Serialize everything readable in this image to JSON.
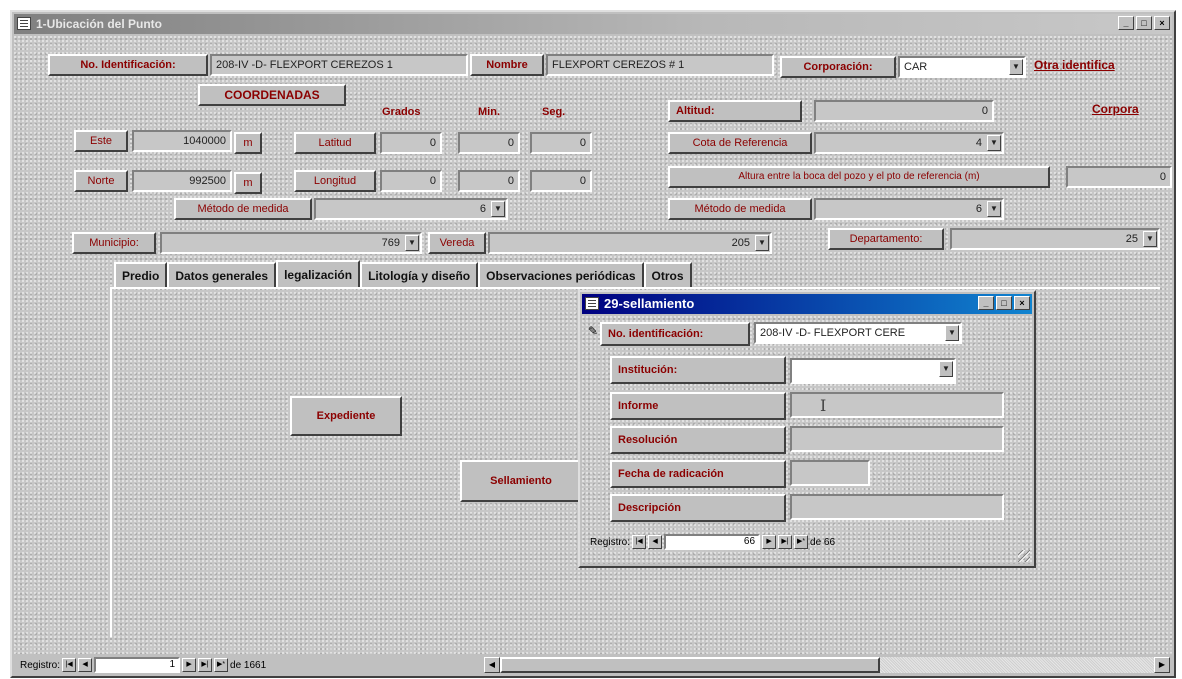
{
  "window": {
    "title": "1-Ubicación del Punto",
    "minimize": "_",
    "restore": "□",
    "close": "×"
  },
  "header": {
    "id_label": "No. Identificación:",
    "id_value": "208-IV -D- FLEXPORT CEREZOS 1",
    "nombre_label": "Nombre",
    "nombre_value": "FLEXPORT CEREZOS # 1",
    "corporacion_label": "Corporación:",
    "corporacion_value": "CAR",
    "otra_identificacion": "Otra identifica",
    "corpora": "Corpora"
  },
  "coordenadas": {
    "title": "COORDENADAS",
    "col_grados": "Grados",
    "col_min": "Min.",
    "col_seg": "Seg.",
    "este_label": "Este",
    "este_value": "1040000",
    "este_unit": "m",
    "latitud_label": "Latitud",
    "lat_grados": "0",
    "lat_min": "0",
    "lat_seg": "0",
    "norte_label": "Norte",
    "norte_value": "992500",
    "norte_unit": "m",
    "longitud_label": "Longitud",
    "lon_grados": "0",
    "lon_min": "0",
    "lon_seg": "0",
    "metodo_label": "Método de medida",
    "metodo_value": "6"
  },
  "altitud": {
    "label": "Altitud:",
    "value": "0",
    "cota_label": "Cota de Referencia",
    "cota_value": "4",
    "altura_label": "Altura entre la boca del pozo y el pto de referencia (m)",
    "altura_value": "0",
    "metodo_label": "Método de medida",
    "metodo_value": "6"
  },
  "location": {
    "municipio_label": "Municipio:",
    "municipio_value": "769",
    "vereda_label": "Vereda",
    "vereda_value": "205",
    "departamento_label": "Departamento:",
    "departamento_value": "25"
  },
  "tabs": [
    {
      "label": "Predio"
    },
    {
      "label": "Datos generales"
    },
    {
      "label": "legalización"
    },
    {
      "label": "Litología y diseño"
    },
    {
      "label": "Observaciones periódicas"
    },
    {
      "label": "Otros"
    }
  ],
  "legalizacion": {
    "expediente_button": "Expediente",
    "sellamiento_button": "Sellamiento"
  },
  "subform": {
    "title": "29-sellamiento",
    "id_label": "No. identificación:",
    "id_value": "208-IV -D- FLEXPORT CERE",
    "institucion_label": "Institución:",
    "institucion_value": "",
    "informe_label": "Informe",
    "informe_value": "",
    "resolucion_label": "Resolución",
    "resolucion_value": "",
    "fecha_label": "Fecha de radicación",
    "fecha_value": "",
    "descripcion_label": "Descripción",
    "descripcion_value": "",
    "record_label": "Registro:",
    "record_current": "66",
    "record_of": "de 66"
  },
  "main_nav": {
    "record_label": "Registro:",
    "record_current": "1",
    "record_of": "de 1661"
  }
}
